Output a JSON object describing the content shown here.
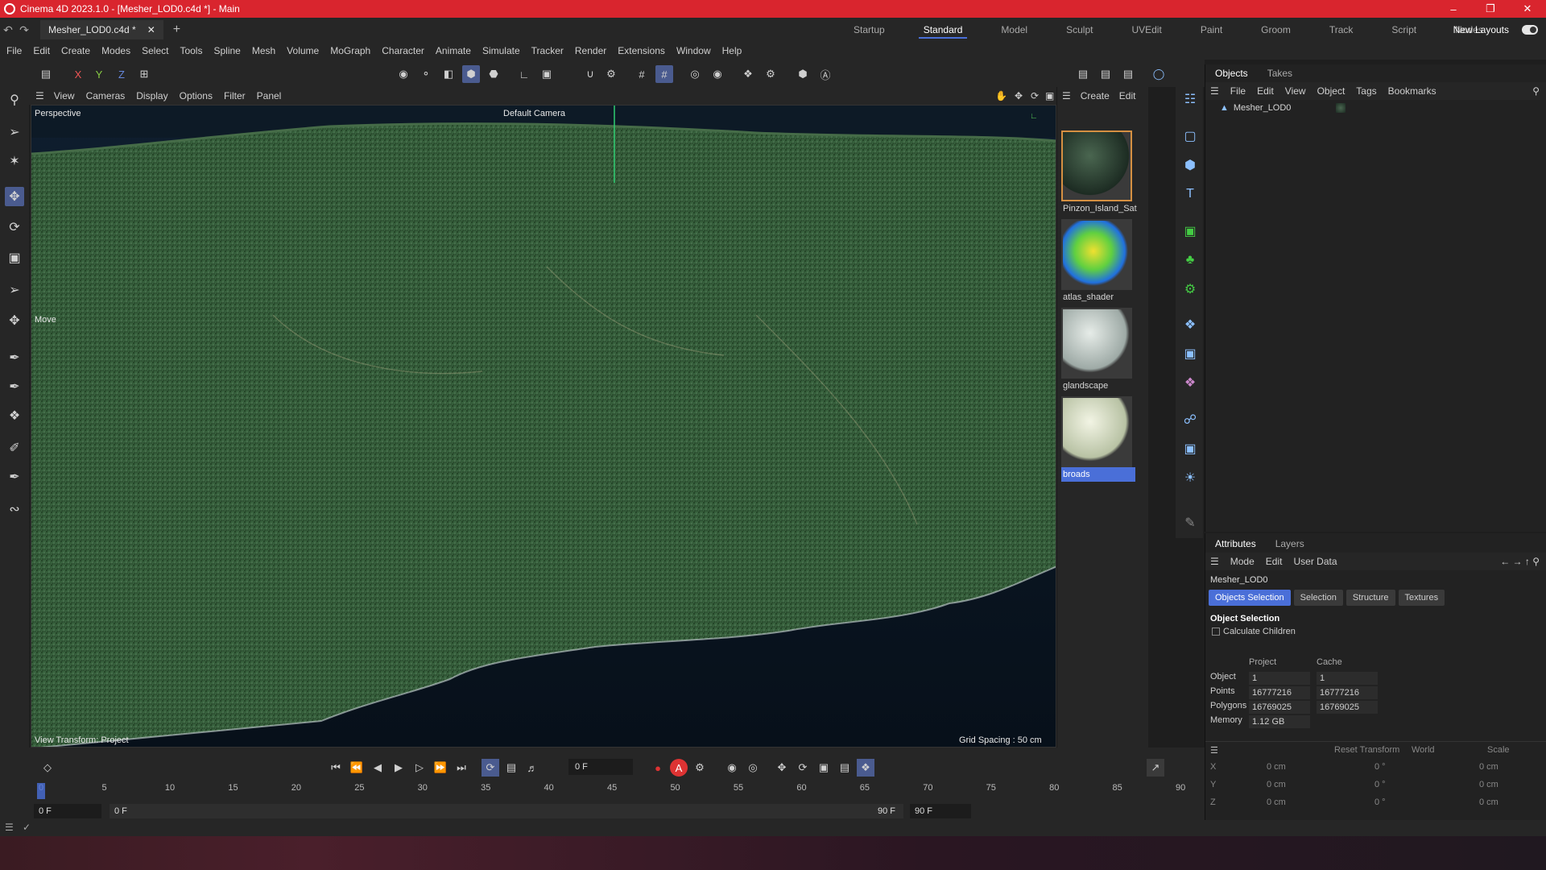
{
  "window": {
    "title": "Cinema 4D 2023.1.0 - [Mesher_LOD0.c4d *] - Main",
    "doc_tab": "Mesher_LOD0.c4d *"
  },
  "layouts": [
    "Startup",
    "Standard",
    "Model",
    "Sculpt",
    "UVEdit",
    "Paint",
    "Groom",
    "Track",
    "Script",
    "Nodes"
  ],
  "layouts_active": "Standard",
  "new_layouts": "New Layouts",
  "menu": [
    "File",
    "Edit",
    "Create",
    "Modes",
    "Select",
    "Tools",
    "Spline",
    "Mesh",
    "Volume",
    "MoGraph",
    "Character",
    "Animate",
    "Simulate",
    "Tracker",
    "Render",
    "Extensions",
    "Window",
    "Help"
  ],
  "axis_buttons": [
    "X",
    "Y",
    "Z"
  ],
  "viewport": {
    "menu": [
      "View",
      "Cameras",
      "Display",
      "Options",
      "Filter",
      "Panel"
    ],
    "projection": "Perspective",
    "camera": "Default Camera",
    "tool": "Move",
    "view_transform": "View Transform: Project",
    "grid_spacing": "Grid Spacing : 50 cm"
  },
  "materials": {
    "menu": [
      "Create",
      "Edit"
    ],
    "items": [
      {
        "name": "Pinzon_Island_Sat"
      },
      {
        "name": "atlas_shader"
      },
      {
        "name": "glandscape"
      },
      {
        "name": "broads"
      }
    ]
  },
  "objects_panel": {
    "tabs": [
      "Objects",
      "Takes"
    ],
    "menu": [
      "File",
      "Edit",
      "View",
      "Object",
      "Tags",
      "Bookmarks"
    ],
    "rows": [
      {
        "name": "Mesher_LOD0"
      }
    ]
  },
  "attributes": {
    "tabs": [
      "Attributes",
      "Layers"
    ],
    "menu": [
      "Mode",
      "Edit",
      "User Data"
    ],
    "object_name": "Mesher_LOD0",
    "subtabs": [
      "Objects Selection",
      "Selection",
      "Structure",
      "Textures"
    ],
    "section": "Object Selection",
    "calc_children": "Calculate Children",
    "col_project": "Project",
    "col_cache": "Cache",
    "stats": [
      {
        "label": "Object",
        "project": "1",
        "cache": "1"
      },
      {
        "label": "Points",
        "project": "16777216",
        "cache": "16777216"
      },
      {
        "label": "Polygons",
        "project": "16769025",
        "cache": "16769025"
      },
      {
        "label": "Memory",
        "project": "1.12 GB",
        "cache": ""
      }
    ],
    "reset_transform": "Reset Transform",
    "space": "World",
    "scale": "Scale",
    "transform_rows": [
      {
        "axis": "X",
        "pos": "0 cm",
        "rot": "0 °",
        "size": "0 cm"
      },
      {
        "axis": "Y",
        "pos": "0 cm",
        "rot": "0 °",
        "size": "0 cm"
      },
      {
        "axis": "Z",
        "pos": "0 cm",
        "rot": "0 °",
        "size": "0 cm"
      }
    ]
  },
  "timeline": {
    "current_frame": "0 F",
    "ticks": [
      "0",
      "5",
      "10",
      "15",
      "20",
      "25",
      "30",
      "35",
      "40",
      "45",
      "50",
      "55",
      "60",
      "65",
      "70",
      "75",
      "80",
      "85",
      "90"
    ],
    "start_field": "0 F",
    "range_start": "0 F",
    "range_end": "90 F",
    "end_field": "90 F"
  },
  "colors": {
    "titlebar": "#d9252e",
    "accent": "#4a6fd8",
    "selected_material_border": "#d59042"
  }
}
